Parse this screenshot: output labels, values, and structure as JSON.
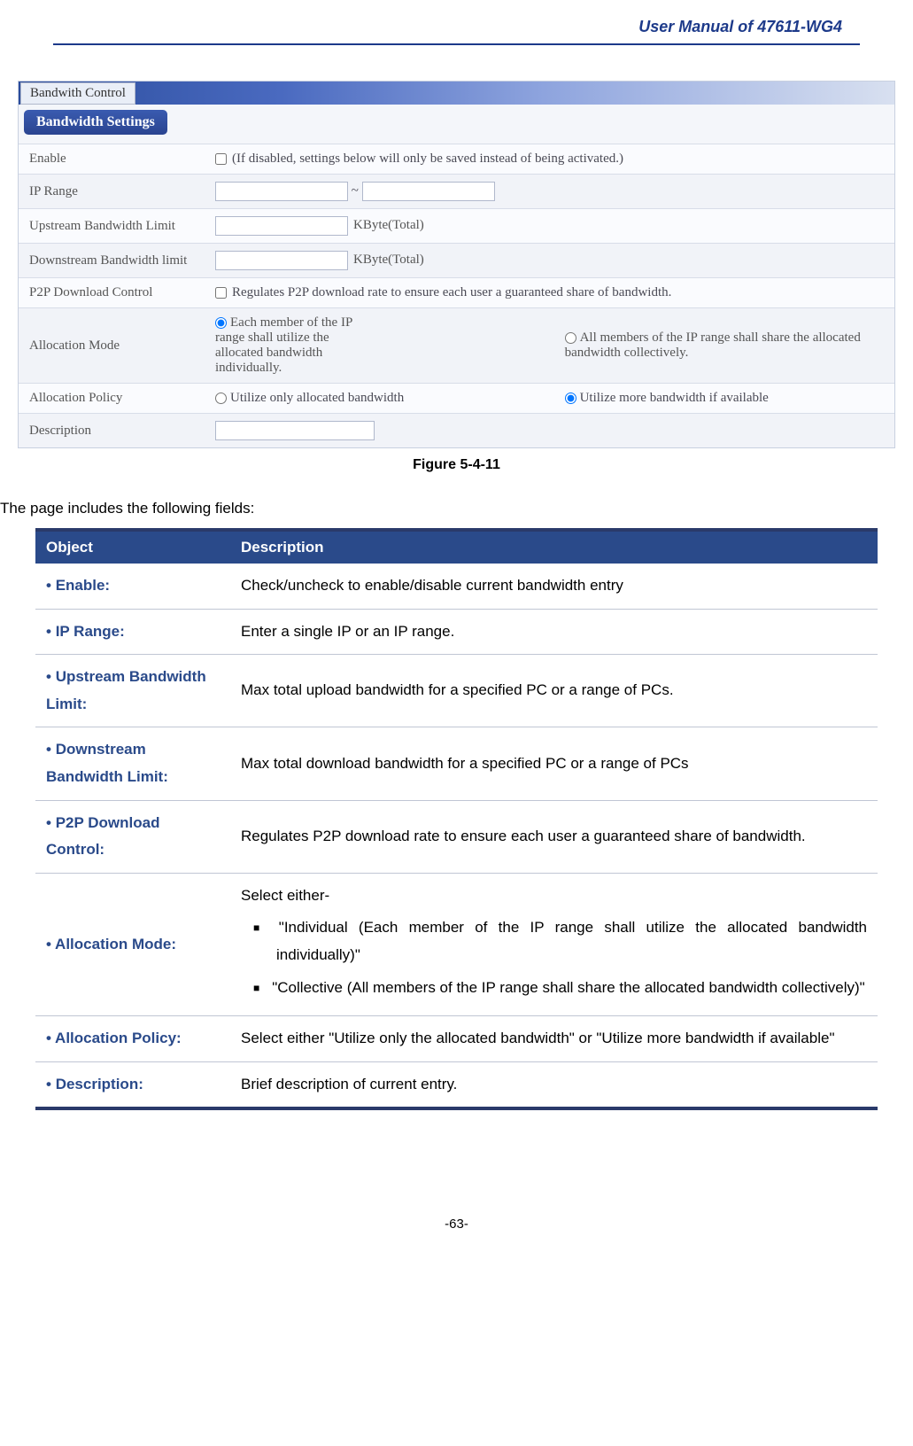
{
  "header": {
    "title": "User Manual of 47611-WG4"
  },
  "panel": {
    "tab": "Bandwith Control",
    "badge": "Bandwidth Settings",
    "rows": {
      "enable": {
        "label": "Enable",
        "note": "(If disabled, settings below will only be saved instead of being activated.)"
      },
      "ip_range": {
        "label": "IP Range"
      },
      "up": {
        "label": "Upstream Bandwidth Limit",
        "unit": "KByte(Total)"
      },
      "down": {
        "label": "Downstream Bandwidth limit",
        "unit": "KByte(Total)"
      },
      "p2p": {
        "label": "P2P Download Control",
        "note": "Regulates P2P download rate to ensure each user a guaranteed share of bandwidth."
      },
      "mode": {
        "label": "Allocation Mode",
        "opt1": "Each member of the IP range shall utilize the allocated bandwidth individually.",
        "opt2": "All members of the IP range shall share the allocated bandwidth collectively."
      },
      "policy": {
        "label": "Allocation Policy",
        "opt1": "Utilize only allocated bandwidth",
        "opt2": "Utilize more bandwidth if available"
      },
      "desc": {
        "label": "Description"
      }
    }
  },
  "caption": "Figure 5-4-11",
  "intro": "The page includes the following fields:",
  "table": {
    "headers": {
      "obj": "Object",
      "desc": "Description"
    },
    "rows": [
      {
        "obj": "Enable:",
        "desc": "Check/uncheck to enable/disable current bandwidth entry"
      },
      {
        "obj": "IP Range:",
        "desc": "Enter a single IP or an IP range."
      },
      {
        "obj": "Upstream Bandwidth Limit:",
        "desc": "Max total upload bandwidth for a specified PC or a range of PCs."
      },
      {
        "obj": "Downstream Bandwidth Limit:",
        "desc": "Max total download bandwidth for a specified PC or a range of PCs"
      },
      {
        "obj": "P2P Download Control:",
        "desc": "Regulates P2P download rate to ensure each user a guaranteed share of bandwidth."
      },
      {
        "obj": "Allocation Mode:",
        "lead": "Select either-",
        "b1": "\"Individual (Each member of the IP range shall utilize the allocated bandwidth individually)\"",
        "b2": "\"Collective (All members of the IP range shall share the allocated bandwidth collectively)\""
      },
      {
        "obj": "Allocation Policy:",
        "desc": "Select either \"Utilize only the allocated bandwidth\" or \"Utilize more bandwidth if available\""
      },
      {
        "obj": "Description:",
        "desc": "Brief description of current entry."
      }
    ]
  },
  "page_number": "-63-"
}
